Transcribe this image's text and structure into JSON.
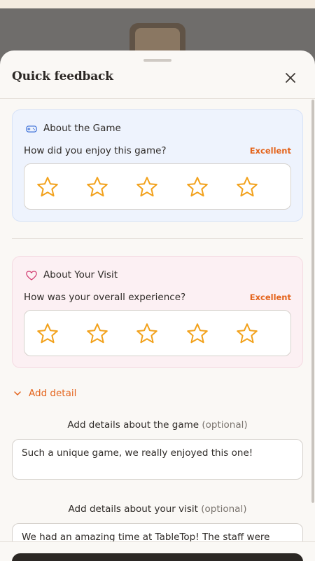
{
  "sheet": {
    "title": "Quick feedback"
  },
  "game_card": {
    "icon": "gamepad-icon",
    "title": "About the Game",
    "question": "How did you enjoy this game?",
    "rating_label": "Excellent",
    "rating": 5,
    "max_rating": 5
  },
  "visit_card": {
    "icon": "heart-icon",
    "title": "About Your Visit",
    "question": "How was your overall experience?",
    "rating_label": "Excellent",
    "rating": 5,
    "max_rating": 5
  },
  "details": {
    "toggle_label": "Add detail",
    "game_label": "Add details about the game",
    "game_optional": "(optional)",
    "game_text": "Such a unique game, we really enjoyed this one!",
    "visit_label": "Add details about your visit",
    "visit_optional": "(optional)",
    "visit_text": "We had an amazing time at TableTop! The staff were super"
  },
  "colors": {
    "accent": "#e4641c",
    "star": "#f2a11b",
    "game_card_bg": "#eef3fd",
    "visit_card_bg": "#fcf0f3",
    "heart": "#d0356b",
    "gamepad": "#3b6fd8"
  }
}
